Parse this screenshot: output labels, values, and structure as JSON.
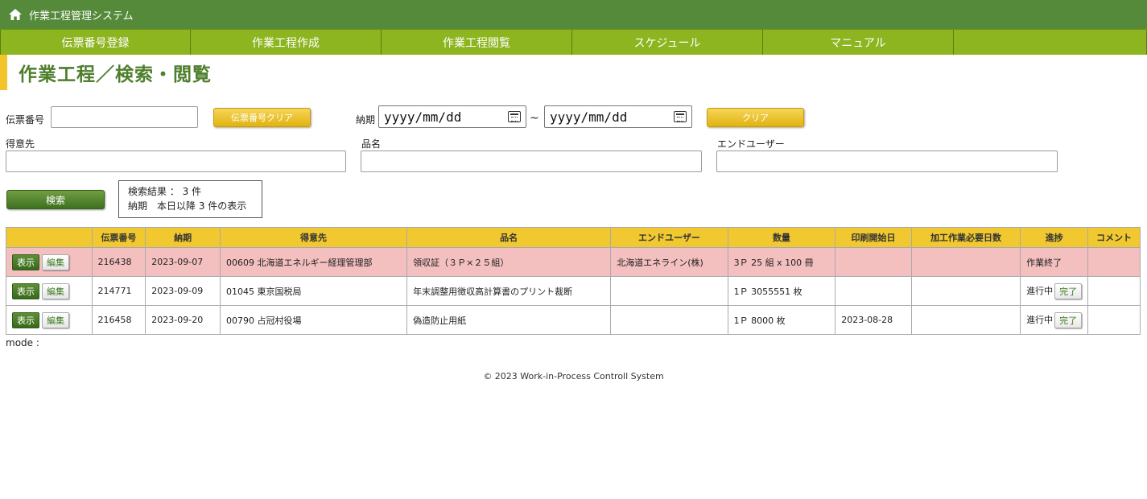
{
  "app": {
    "title": "作業工程管理システム",
    "home_icon": "home-icon"
  },
  "nav": [
    "伝票番号登録",
    "作業工程作成",
    "作業工程閲覧",
    "スケジュール",
    "マニュアル"
  ],
  "page": {
    "title": "作業工程／検索・閲覧"
  },
  "search": {
    "slip_label": "伝票番号",
    "slip_value": "",
    "slip_clear": "伝票番号クリア",
    "due_label": "納期",
    "date_from": "yyyy/mm/dd",
    "date_sep": "~",
    "date_to": "yyyy/mm/dd",
    "clear": "クリア",
    "customer_label": "得意先",
    "customer_value": "",
    "product_label": "品名",
    "product_value": "",
    "enduser_label": "エンドユーザー",
    "enduser_value": "",
    "search_button": "検索"
  },
  "result": {
    "line1": "検索結果 ： 3 件",
    "line2": "納期　本日以降 3 件の表示"
  },
  "table": {
    "headers": [
      "",
      "伝票番号",
      "納期",
      "得意先",
      "品名",
      "エンドユーザー",
      "数量",
      "印刷開始日",
      "加工作業必要日数",
      "進捗",
      "コメント"
    ],
    "show_label": "表示",
    "edit_label": "編集",
    "done_label": "完了",
    "rows": [
      {
        "slip": "216438",
        "due": "2023-09-07",
        "customer": "00609 北海道エネルギー経理管理部",
        "product": "領収証（３Ｐ×２５組）",
        "enduser": "北海道エネライン(株)",
        "qty": "3Ｐ 25 組 x 100 冊",
        "print_start": "",
        "days": "",
        "progress": "作業終了",
        "comment": "",
        "completed": true
      },
      {
        "slip": "214771",
        "due": "2023-09-09",
        "customer": "01045 東京国税局",
        "product": "年末調整用徴収高計算書のプリント裁断",
        "enduser": "",
        "qty": "1Ｐ 3055551 枚",
        "print_start": "",
        "days": "",
        "progress": "進行中",
        "comment": "",
        "completed": false
      },
      {
        "slip": "216458",
        "due": "2023-09-20",
        "customer": "00790 占冠村役場",
        "product": "偽造防止用紙",
        "enduser": "",
        "qty": "1Ｐ 8000 枚",
        "print_start": "2023-08-28",
        "days": "",
        "progress": "進行中",
        "comment": "",
        "completed": false
      }
    ]
  },
  "mode_label": "mode :",
  "footer": "© 2023 Work-in-Process Controll System"
}
